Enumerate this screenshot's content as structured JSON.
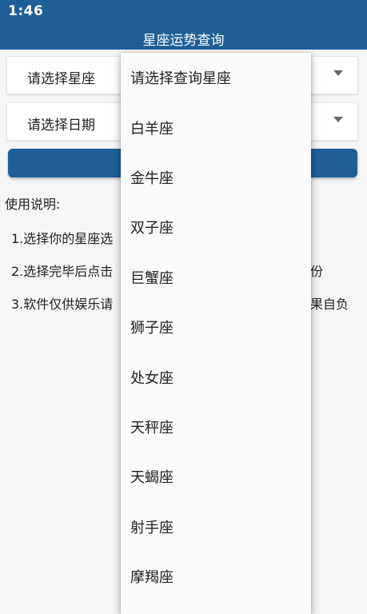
{
  "status": {
    "time": "1:46"
  },
  "header": {
    "title": "星座运势查询"
  },
  "spinners": {
    "sign_label": "请选择星座",
    "date_label": "请选择日期"
  },
  "instructions": {
    "title": "使用说明:",
    "line1": "1.选择你的星座选",
    "line2": "2.选择完毕后点击",
    "line2_tail": "份",
    "line3": "3.软件仅供娱乐请",
    "line3_tail": "果自负"
  },
  "dropdown": {
    "items": [
      "请选择查询星座",
      "白羊座",
      "金牛座",
      "双子座",
      "巨蟹座",
      "狮子座",
      "处女座",
      "天秤座",
      "天蝎座",
      "射手座",
      "摩羯座"
    ]
  },
  "colors": {
    "primary": "#1f5f98"
  }
}
